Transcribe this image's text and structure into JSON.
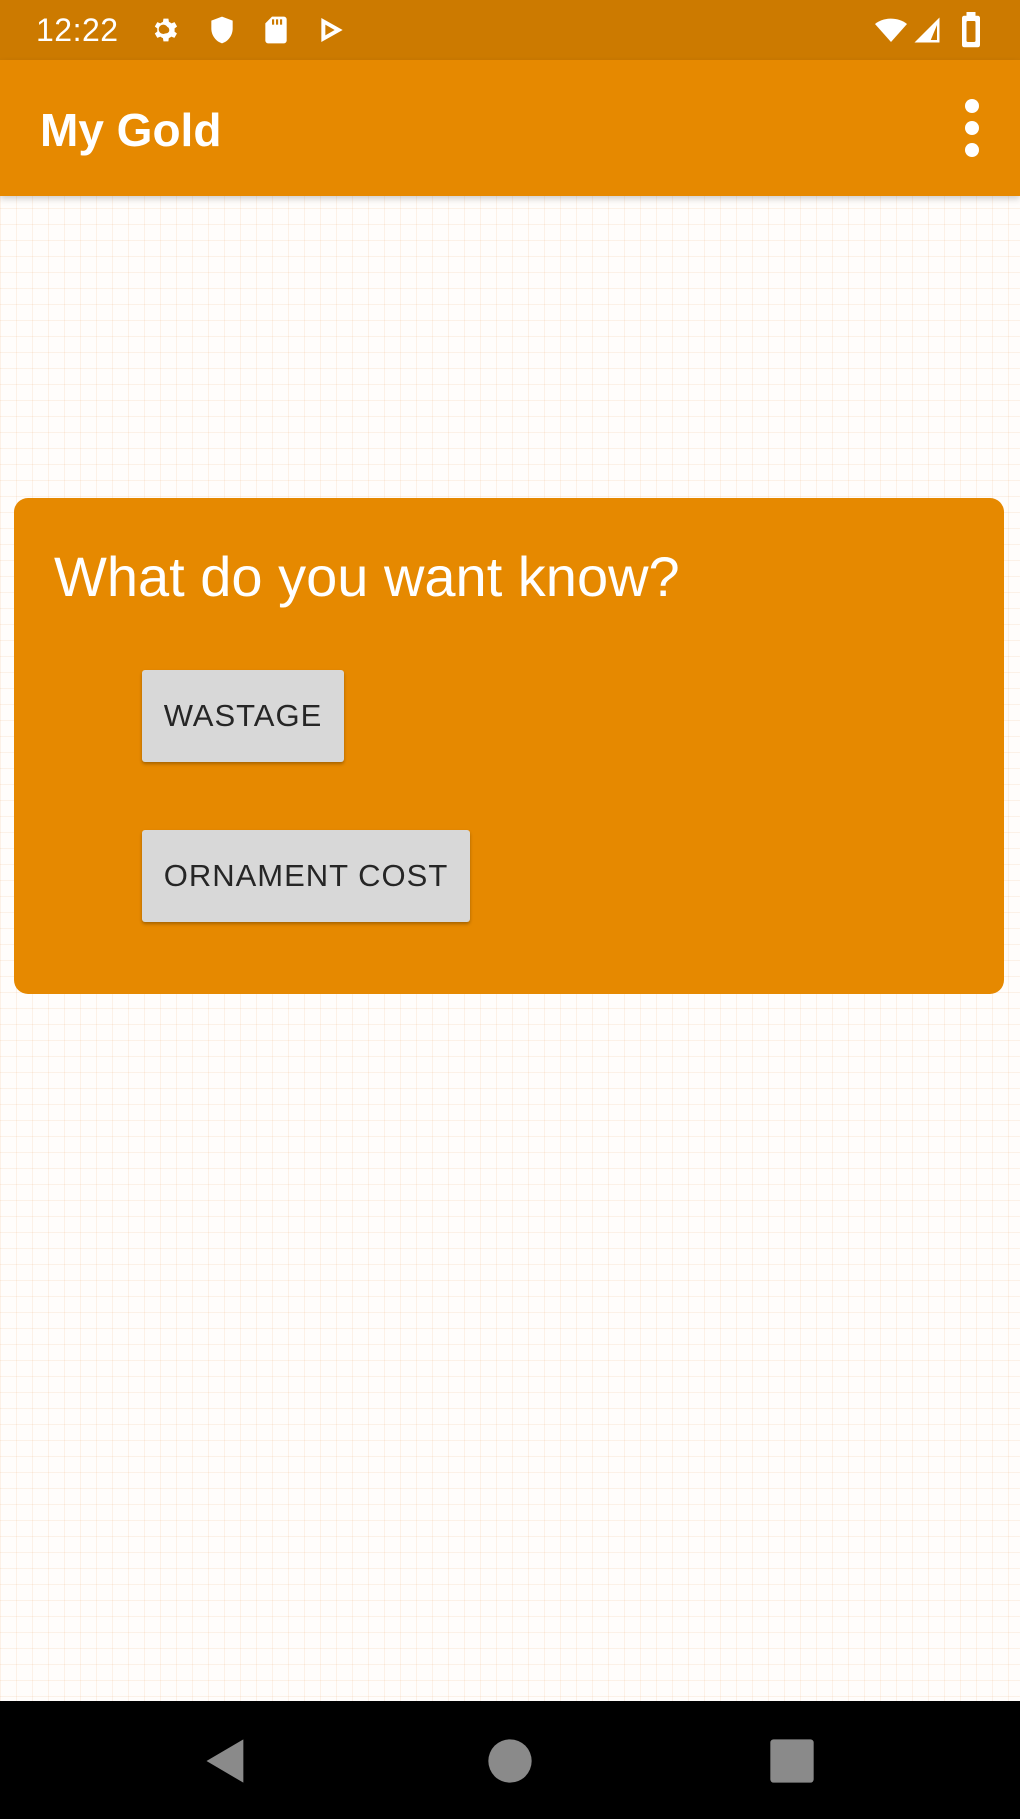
{
  "status_bar": {
    "time": "12:22",
    "icons_left": [
      "settings-icon",
      "shield-icon",
      "sd-card-icon",
      "play-store-icon"
    ],
    "icons_right": [
      "wifi-icon",
      "signal-icon",
      "battery-icon"
    ]
  },
  "app_bar": {
    "title": "My Gold",
    "overflow_icon": "more-vert-icon"
  },
  "card": {
    "heading": "What do you want know?",
    "buttons": [
      {
        "label": "WASTAGE"
      },
      {
        "label": "ORNAMENT COST"
      }
    ]
  },
  "nav_bar": {
    "buttons": [
      "back-icon",
      "home-icon",
      "recents-icon"
    ]
  },
  "colors": {
    "status_bar": "#cc7a00",
    "primary": "#e68900",
    "button": "#d8d8d8",
    "background": "#fffdfb"
  }
}
